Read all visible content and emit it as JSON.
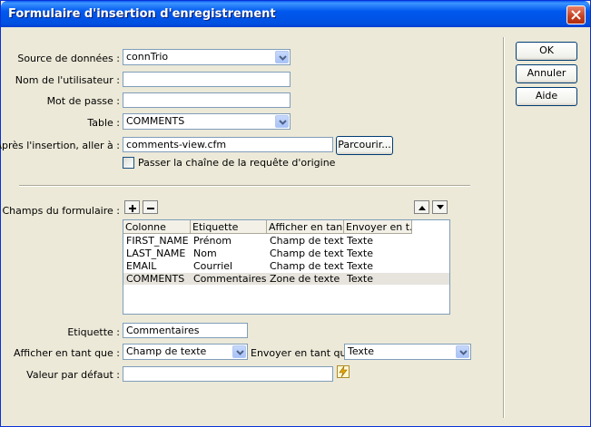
{
  "window": {
    "title": "Formulaire d'insertion d'enregistrement"
  },
  "form": {
    "source": {
      "label": "Source de données :",
      "value": "connTrio"
    },
    "user": {
      "label": "Nom de l'utilisateur :",
      "value": ""
    },
    "password": {
      "label": "Mot de passe :",
      "value": ""
    },
    "table": {
      "label": "Table :",
      "value": "COMMENTS"
    },
    "after_insert": {
      "label": "Après l'insertion, aller à :",
      "value": "comments-view.cfm",
      "browse_label": "Parcourir..."
    },
    "pass_query": {
      "label": "Passer la chaîne de la requête d'origine",
      "checked": false
    }
  },
  "buttons": {
    "ok": "OK",
    "cancel": "Annuler",
    "help": "Aide"
  },
  "fields": {
    "label": "Champs du formulaire :",
    "add": "+",
    "remove": "−",
    "columns": [
      "Colonne",
      "Etiquette",
      "Afficher en tan...",
      "Envoyer en t..."
    ],
    "rows": [
      {
        "colonne": "FIRST_NAME",
        "etiquette": "Prénom",
        "afficher": "Champ de texte",
        "envoyer": "Texte",
        "selected": false
      },
      {
        "colonne": "LAST_NAME",
        "etiquette": "Nom",
        "afficher": "Champ de texte",
        "envoyer": "Texte",
        "selected": false
      },
      {
        "colonne": "EMAIL",
        "etiquette": "Courriel",
        "afficher": "Champ de texte",
        "envoyer": "Texte",
        "selected": false
      },
      {
        "colonne": "COMMENTS",
        "etiquette": "Commentaires",
        "afficher": "Zone de texte",
        "envoyer": "Texte",
        "selected": true
      }
    ]
  },
  "detail": {
    "etiquette": {
      "label": "Etiquette :",
      "value": "Commentaires"
    },
    "display_as": {
      "label": "Afficher en tant que :",
      "value": "Champ de texte"
    },
    "submit_as": {
      "label": "Envoyer en tant que :",
      "value": "Texte"
    },
    "default_value": {
      "label": "Valeur par défaut :",
      "value": ""
    }
  },
  "colors": {
    "titlebar": "#0058ee",
    "close": "#c4401f",
    "dialog_bg": "#ece9d8"
  },
  "icons": {
    "close": "close-icon",
    "dropdown": "chevron-down-icon",
    "move_up": "triangle-up-icon",
    "move_down": "triangle-down-icon",
    "dynamic": "lightning-icon"
  }
}
